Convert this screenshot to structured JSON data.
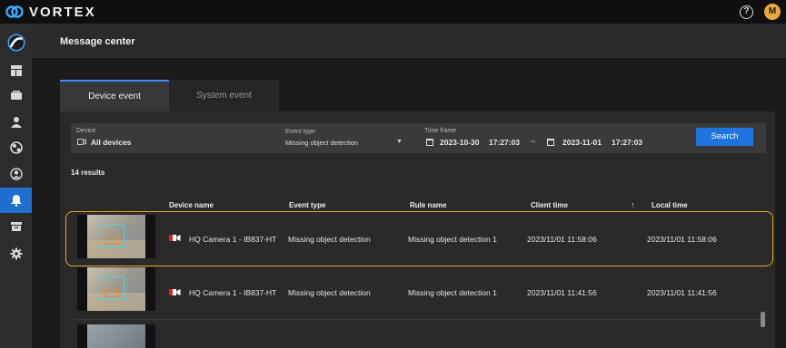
{
  "app": {
    "brand": "VORTEX",
    "avatar_initial": "M",
    "help_glyph": "?"
  },
  "header": {
    "title": "Message center"
  },
  "tabs": [
    {
      "label": "Device event",
      "active": true
    },
    {
      "label": "System event",
      "active": false
    }
  ],
  "filters": {
    "device_label": "Device",
    "device_value": "All devices",
    "event_type_label": "Event type",
    "event_type_value": "Missing object detection",
    "time_frame_label": "Time frame",
    "start_date": "2023-10-30",
    "start_time": "17:27:03",
    "range_sep": "~",
    "end_date": "2023-11-01",
    "end_time": "17:27:03",
    "search_label": "Search"
  },
  "results_text": "14 results",
  "columns": {
    "device_name": "Device name",
    "event_type": "Event type",
    "rule_name": "Rule name",
    "client_time": "Client time",
    "sort_glyph": "↑",
    "local_time": "Local time"
  },
  "rows": [
    {
      "device": "HQ Camera 1 - IB837-HT",
      "event": "Missing object detection",
      "rule": "Missing object detection 1",
      "client_time": "2023/11/01 11:58:06",
      "local_time": "2023/11/01 11:58:06",
      "selected": true
    },
    {
      "device": "HQ Camera 1 - IB837-HT",
      "event": "Missing object detection",
      "rule": "Missing object detection 1",
      "client_time": "2023/11/01 11:41:56",
      "local_time": "2023/11/01 11:41:56",
      "selected": false
    }
  ],
  "icons": {
    "sidebar": [
      "vortex-logo-icon",
      "dashboard-icon",
      "devices-icon",
      "user-icon",
      "alerts-filter-icon",
      "account-icon",
      "notification-bell-icon",
      "archive-icon",
      "settings-gear-icon"
    ],
    "accent": "#1f6fd1",
    "highlight": "#e6a82a"
  }
}
